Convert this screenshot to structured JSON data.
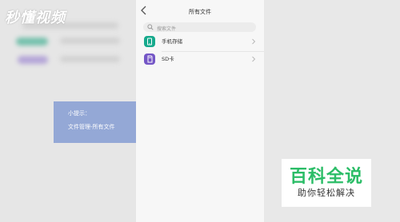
{
  "watermark": {
    "logo_text": "秒懂视频",
    "baike_title": "百科全说",
    "baike_subtitle": "助你轻松解决"
  },
  "screen": {
    "title": "所有文件",
    "search_placeholder": "搜索文件",
    "items": [
      {
        "label": "手机存储",
        "icon": "phone-icon",
        "color": "#16a98c"
      },
      {
        "label": "SD卡",
        "icon": "sd-card-icon",
        "color": "#7456c6"
      }
    ]
  },
  "tip": {
    "title": "小提示：",
    "body": "文件管理-所有文件"
  }
}
